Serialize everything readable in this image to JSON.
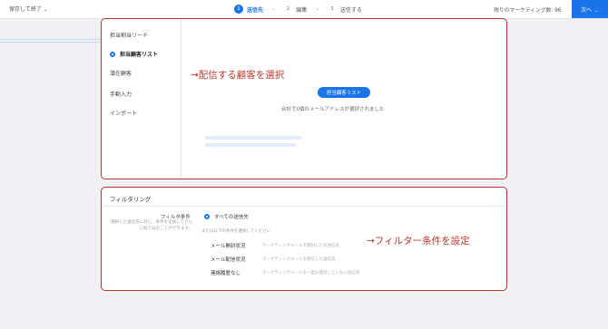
{
  "topbar": {
    "save_exit": "保存して終了 ⌄",
    "steps": [
      {
        "num": "1",
        "label": "送信先"
      },
      {
        "num": "2",
        "label": "編集"
      },
      {
        "num": "3",
        "label": "送信する"
      }
    ],
    "remaining": "残りのマーケティング数: 96",
    "next_label": "次へ →"
  },
  "recipients": {
    "options": [
      "担当割当リード",
      "担当顧客リスト",
      "潜在顧客",
      "手動入力",
      "インポート"
    ],
    "annotation": "→配信する顧客を選択",
    "button_label": "担当顧客リスト",
    "summary": "合計で0個のメールアドレスが選択されました"
  },
  "filtering": {
    "title": "フィルタリング",
    "condition_label": "フィルタ条件",
    "condition_desc": "選択した送信先に対し、条件を追加してさらに絞り込むことができます。",
    "all_recipients": "すべての送信先",
    "hint": "または以下の条件を選択してください",
    "rows": [
      {
        "label": "メール開封状況",
        "desc": "マーケティングメールを開封したの送信先"
      },
      {
        "label": "メール配信状況",
        "desc": "マーケティングメールを受信した送信先"
      },
      {
        "label": "連絡履歴なし",
        "desc": "マーケティングメールを一度も開封していない送信先"
      }
    ],
    "annotation": "→フィルター条件を設定"
  },
  "colors": {
    "accent": "#1a73e8",
    "annotation": "#c0392b",
    "frame": "#b33a2a"
  }
}
